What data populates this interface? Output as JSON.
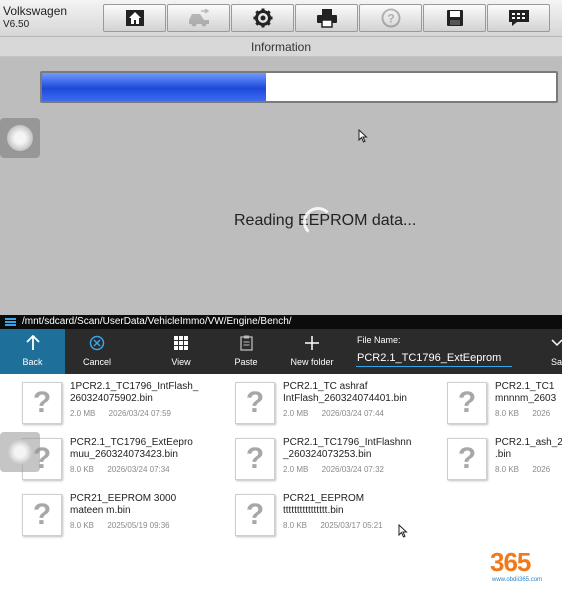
{
  "app": {
    "brand": "Volkswagen",
    "version": "V6.50"
  },
  "toolbar": {
    "buttons": [
      {
        "name": "home-icon",
        "enabled": true
      },
      {
        "name": "vehicle-swap-icon",
        "enabled": false
      },
      {
        "name": "settings-gear-icon",
        "enabled": true
      },
      {
        "name": "print-icon",
        "enabled": true
      },
      {
        "name": "help-icon",
        "enabled": false
      },
      {
        "name": "save-disk-icon",
        "enabled": true
      },
      {
        "name": "message-icon",
        "enabled": true
      }
    ]
  },
  "header": {
    "title": "Information"
  },
  "progress": {
    "fraction": 0.435
  },
  "status": {
    "text": "Reading EEPROM data..."
  },
  "chooser": {
    "path": "/mnt/sdcard/Scan/UserData/VehicleImmo/VW/Engine/Bench/",
    "buttons": {
      "back": "Back",
      "cancel": "Cancel",
      "view": "View",
      "paste": "Paste",
      "new_folder": "New folder",
      "save_partial": "Sa"
    },
    "file_name_label": "File Name:",
    "file_name_value": "PCR2.1_TC1796_ExtEeprom",
    "files": [
      {
        "name": "1PCR2.1_TC1796_IntFlash_\n260324075902.bin",
        "meta": "2.0 MB      2026/03/24 07:59"
      },
      {
        "name": "PCR2.1_TC ashraf\nIntFlash_260324074401.bin",
        "meta": "2.0 MB      2026/03/24 07:44"
      },
      {
        "name": "PCR2.1_TC1\nmnnnm_2603",
        "meta": "8.0 KB      2026"
      },
      {
        "name": "PCR2.1_TC1796_ExtEepro\nmuu_260324073423.bin",
        "meta": "8.0 KB      2026/03/24 07:34"
      },
      {
        "name": "PCR2.1_TC1796_IntFlashnn\n_260324073253.bin",
        "meta": "2.0 MB      2026/03/24 07:32"
      },
      {
        "name": "PCR2.1_ash_2\n.bin",
        "meta": "8.0 KB      2026"
      },
      {
        "name": "PCR21_EEPROM 3000\nmateen m.bin",
        "meta": "8.0 KB      2025/05/19 09:36"
      },
      {
        "name": "PCR21_EEPROM\ntttttttttttttttt.bin",
        "meta": "8.0 KB      2025/03/17 05:21"
      }
    ]
  },
  "watermark": {
    "logo": "365",
    "url": "www.obdii365.com"
  },
  "colors": {
    "progress": "#2a57e6",
    "accent": "#35a7e8",
    "back_button": "#1e6f9a"
  }
}
